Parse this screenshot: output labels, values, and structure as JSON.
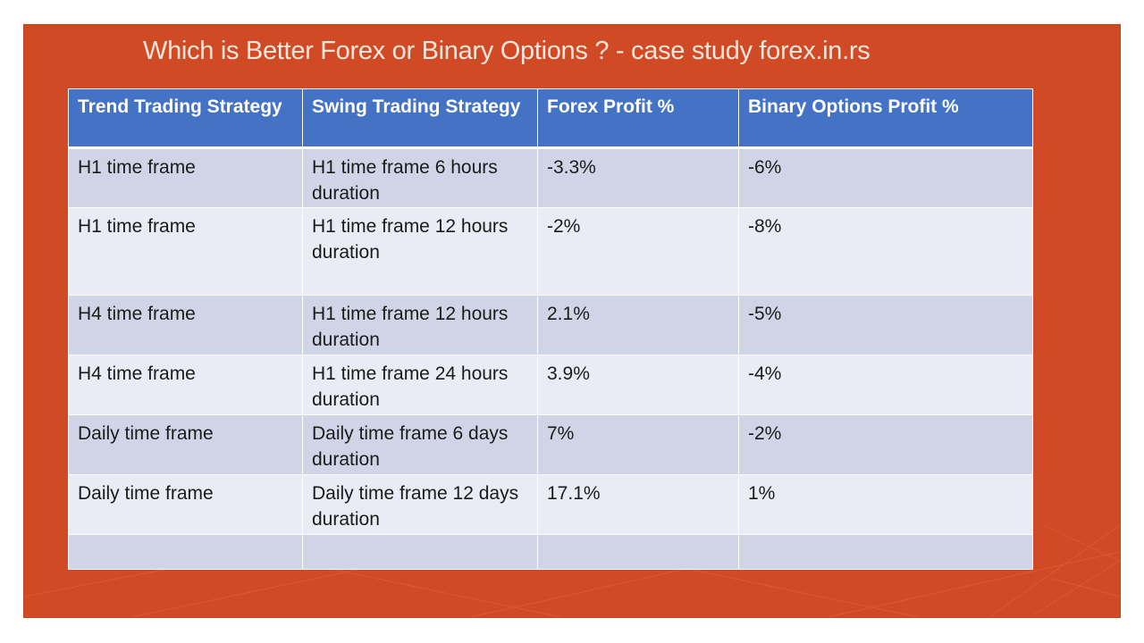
{
  "slide": {
    "title": "Which is Better Forex or Binary Options ? - case study forex.in.rs",
    "colors": {
      "background": "#d04a25",
      "header": "#4472c4",
      "row_odd": "#cfd5e7",
      "row_even": "#e9ebf5",
      "title_text": "#fbe6dc"
    }
  },
  "table": {
    "headers": [
      "Trend Trading Strategy",
      "Swing Trading Strategy",
      "Forex Profit %",
      "Binary Options Profit %"
    ],
    "rows": [
      [
        "H1 time frame",
        "H1 time frame 6 hours duration",
        "-3.3%",
        "-6%"
      ],
      [
        "H1 time frame",
        "H1 time frame 12 hours duration",
        "-2%",
        "-8%"
      ],
      [
        "H4 time frame",
        "H1 time frame 12 hours duration",
        "2.1%",
        "-5%"
      ],
      [
        "H4 time frame",
        "H1 time frame 24 hours duration",
        "3.9%",
        "-4%"
      ],
      [
        "Daily time frame",
        "Daily time frame 6 days duration",
        "7%",
        "-2%"
      ],
      [
        "Daily time frame",
        "Daily time frame 12 days duration",
        "17.1%",
        "1%"
      ],
      [
        "",
        "",
        "",
        ""
      ]
    ]
  }
}
